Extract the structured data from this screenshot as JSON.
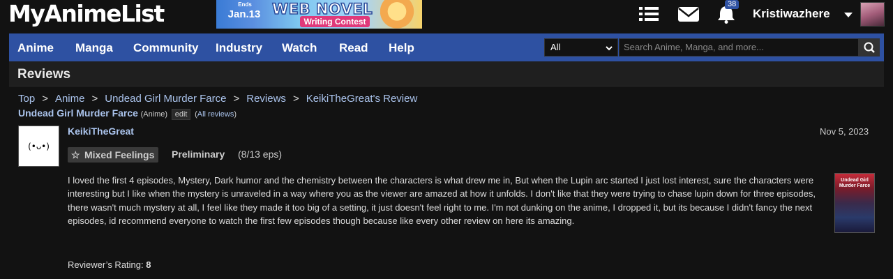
{
  "header": {
    "logo": "MyAnimeList",
    "banner": {
      "ends": "Ends",
      "date": "Jan.13",
      "title": "WEB NOVEL",
      "subtitle": "Writing Contest"
    },
    "notifications_count": "38",
    "username": "Kristiwazhere"
  },
  "nav": {
    "items": [
      "Anime",
      "Manga",
      "Community",
      "Industry",
      "Watch",
      "Read",
      "Help"
    ],
    "search": {
      "category": "All",
      "placeholder": "Search Anime, Manga, and more..."
    }
  },
  "page": {
    "title": "Reviews"
  },
  "breadcrumb": [
    "Top",
    "Anime",
    "Undead Girl Murder Farce",
    "Reviews",
    "KeikiTheGreat's Review"
  ],
  "subline": {
    "anime": "Undead Girl Murder Farce",
    "type": "(Anime)",
    "edit": "edit",
    "all_reviews": "All reviews"
  },
  "review": {
    "user": "KeikiTheGreat",
    "avatar_text": "(•ᴗ•)",
    "date": "Nov 5, 2023",
    "tag": "Mixed Feelings",
    "status": "Preliminary",
    "progress": "(8/13 eps)",
    "body": "I loved the first 4 episodes, Mystery, Dark humor and the chemistry between the characters is what drew me in, But when the Lupin arc started I just lost interest, sure the characters were interesting but I like when the mystery is unraveled in a way where you as the viewer are amazed at how it unfolds. I don't like that they were trying to chase lupin down for three episodes, there wasn't much mystery at all, I feel like they made it too big of a setting, it just doesn't feel right to me. I'm not dunking on the anime, I dropped it, but its because I didn't fancy the next episodes, id recommend everyone to watch the first few episodes though because like every other review on here its amazing.",
    "rating_label": "Reviewer’s Rating:",
    "rating_value": "8"
  },
  "colors": {
    "nav_bg": "#2e51a2",
    "link": "#abc4ed",
    "page_bg": "#121212"
  }
}
